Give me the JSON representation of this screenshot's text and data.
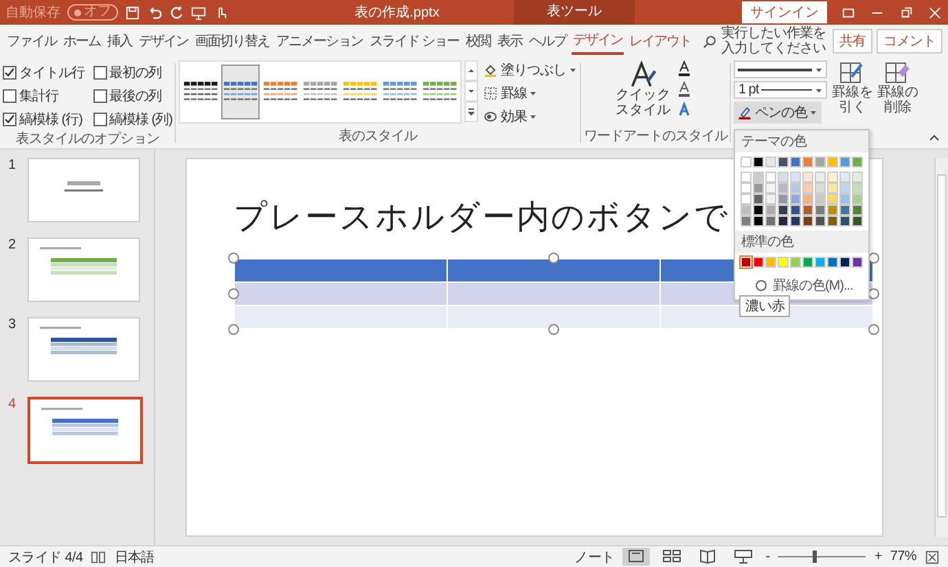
{
  "title_bar": {
    "autosave_label": "自動保存",
    "autosave_toggle": {
      "label": "オフ",
      "on": false
    },
    "file_name": "表の作成.pptx",
    "context_label": "表ツール",
    "signin": "サインイン"
  },
  "tabs": [
    {
      "label": "ファイル",
      "selected": false,
      "kind": "normal"
    },
    {
      "label": "ホーム",
      "selected": false,
      "kind": "normal"
    },
    {
      "label": "挿入",
      "selected": false,
      "kind": "normal"
    },
    {
      "label": "デザイン",
      "selected": false,
      "kind": "normal"
    },
    {
      "label": "画面切り替え",
      "selected": false,
      "kind": "normal"
    },
    {
      "label": "アニメーション",
      "selected": false,
      "kind": "normal"
    },
    {
      "label": "スライド ショー",
      "selected": false,
      "kind": "normal"
    },
    {
      "label": "校閲",
      "selected": false,
      "kind": "normal"
    },
    {
      "label": "表示",
      "selected": false,
      "kind": "normal"
    },
    {
      "label": "ヘルプ",
      "selected": false,
      "kind": "normal"
    },
    {
      "label": "デザイン",
      "selected": true,
      "kind": "contextual"
    },
    {
      "label": "レイアウト",
      "selected": false,
      "kind": "contextual"
    }
  ],
  "search": {
    "placeholder": "実行したい作業を入力してください"
  },
  "share": "共有",
  "comment": "コメント",
  "style_options": {
    "label": "表スタイルのオプション",
    "items": [
      {
        "label": "タイトル行",
        "checked": true
      },
      {
        "label": "最初の列",
        "checked": false
      },
      {
        "label": "集計行",
        "checked": false
      },
      {
        "label": "最後の列",
        "checked": false
      },
      {
        "label": "縞模様 (行)",
        "checked": true
      },
      {
        "label": "縞模様 (列)",
        "checked": false
      }
    ]
  },
  "table_styles": {
    "label": "表のスタイル",
    "items": [
      {
        "color": "#1a1a1a",
        "selected": false
      },
      {
        "color": "#4472c4",
        "selected": true
      },
      {
        "color": "#ed7d31",
        "selected": false
      },
      {
        "color": "#a5a5a5",
        "selected": false
      },
      {
        "color": "#ffc000",
        "selected": false
      },
      {
        "color": "#5b9bd5",
        "selected": false
      },
      {
        "color": "#70ad47",
        "selected": false
      }
    ],
    "commands": [
      {
        "label": "塗りつぶし",
        "kind": "fill"
      },
      {
        "label": "罫線",
        "kind": "border"
      },
      {
        "label": "効果",
        "kind": "effect"
      }
    ]
  },
  "wordart": {
    "label": "ワードアートのスタイル",
    "quick_style": "クイックスタイル"
  },
  "borders": {
    "line_weight": "1 pt",
    "pen_color": {
      "label": "ペンの色",
      "color": "#c00000"
    },
    "draw": "罫線を引く",
    "erase": "罫線の削除"
  },
  "color_menu": {
    "theme_label": "テーマの色",
    "theme_colors": [
      {
        "color": "#ffffff"
      },
      {
        "color": "#000000"
      },
      {
        "color": "#e7e6e6"
      },
      {
        "color": "#44546a"
      },
      {
        "color": "#4472c4"
      },
      {
        "color": "#ed7d31"
      },
      {
        "color": "#a5a5a5"
      },
      {
        "color": "#ffc000"
      },
      {
        "color": "#5b9bd5"
      },
      {
        "color": "#70ad47"
      }
    ],
    "standard_label": "標準の色",
    "standard_colors": [
      {
        "color": "#c00000",
        "selected": true
      },
      {
        "color": "#ff0000",
        "selected": false
      },
      {
        "color": "#ffc000",
        "selected": false
      },
      {
        "color": "#ffff00",
        "selected": false
      },
      {
        "color": "#92d050",
        "selected": false
      },
      {
        "color": "#00b050",
        "selected": false
      },
      {
        "color": "#00b0f0",
        "selected": false
      },
      {
        "color": "#0070c0",
        "selected": false
      },
      {
        "color": "#002060",
        "selected": false
      },
      {
        "color": "#7030a0",
        "selected": false
      }
    ],
    "more": "罫線の色(M)...",
    "tooltip": "濃い赤"
  },
  "slides": [
    {
      "number": "1",
      "selected": false,
      "kind": "title"
    },
    {
      "number": "2",
      "selected": false,
      "kind": "table",
      "color": "#70ad47"
    },
    {
      "number": "3",
      "selected": false,
      "kind": "table",
      "color": "#2f5597"
    },
    {
      "number": "4",
      "selected": true,
      "kind": "table",
      "color": "#4472c4"
    }
  ],
  "slide": {
    "title": "プレースホルダー内のボタンで",
    "table": {
      "selected": true,
      "rows": [
        {
          "kind": "header",
          "cells": [
            {
              "kind": "empty"
            },
            {
              "kind": "empty"
            },
            {
              "kind": "empty"
            }
          ]
        },
        {
          "kind": "banded",
          "cells": [
            {
              "kind": "empty"
            },
            {
              "kind": "empty"
            },
            {
              "kind": "empty"
            }
          ]
        },
        {
          "kind": "plain",
          "cells": [
            {
              "kind": "empty"
            },
            {
              "kind": "empty"
            },
            {
              "kind": "empty"
            }
          ]
        }
      ]
    }
  },
  "status_bar": {
    "slide_indicator": "スライド 4/4",
    "language": "日本語",
    "notes": "ノート",
    "views": [
      {
        "kind": "normal",
        "selected": true
      },
      {
        "kind": "sorter",
        "selected": false
      },
      {
        "kind": "reading",
        "selected": false
      },
      {
        "kind": "slideshow",
        "selected": false
      }
    ],
    "zoom_out": "-",
    "zoom": {
      "level": 0.42
    },
    "zoom_in": "+",
    "zoom_value": "77%"
  }
}
